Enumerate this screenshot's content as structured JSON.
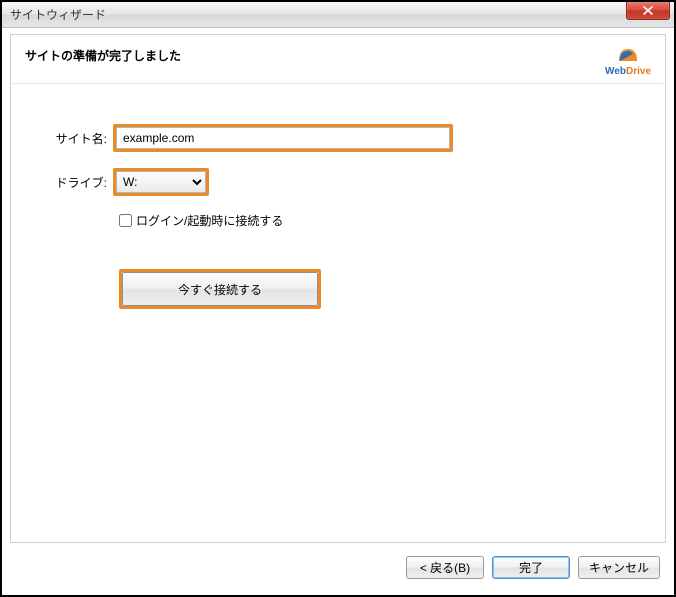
{
  "window": {
    "title": "サイトウィザード"
  },
  "header": {
    "page_title": "サイトの準備が完了しました",
    "logo_web": "Web",
    "logo_drive": "Drive"
  },
  "form": {
    "site_name_label": "サイト名:",
    "site_name_value": "example.com",
    "drive_label": "ドライブ:",
    "drive_value": "W:",
    "connect_on_login_label": "ログイン/起動時に接続する",
    "connect_now_label": "今すぐ接続する"
  },
  "footer": {
    "back_label": "< 戻る(B)",
    "finish_label": "完了",
    "cancel_label": "キャンセル"
  }
}
